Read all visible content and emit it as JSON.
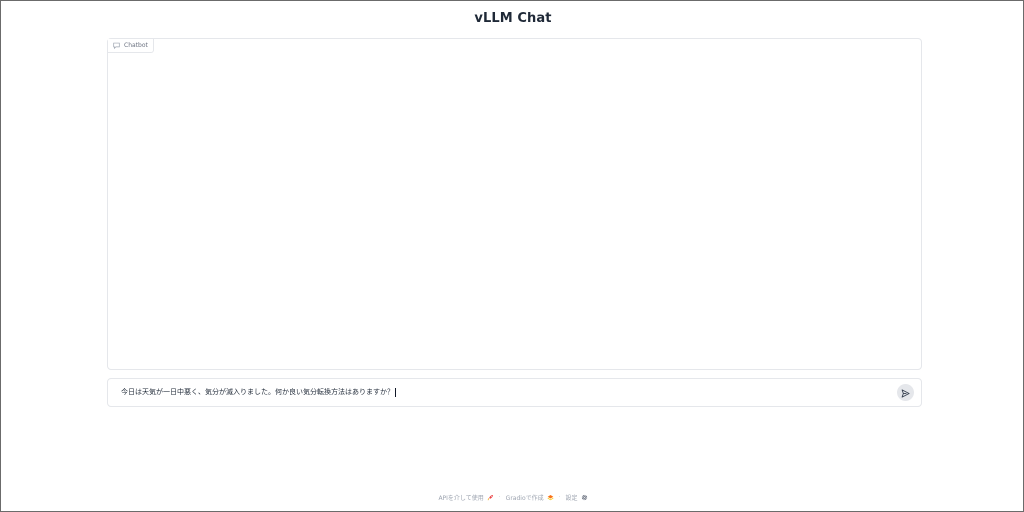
{
  "app": {
    "title": "vLLM Chat"
  },
  "chatbot": {
    "label": "Chatbot",
    "label_icon": "chat-bubble-icon"
  },
  "input": {
    "value": "今日は天気が一日中悪く、気分が滅入りました。何か良い気分転換方法はありますか？",
    "send_icon": "send-icon"
  },
  "footer": {
    "api_label": "APIを介して使用",
    "api_icon": "rocket-icon",
    "gradio_label": "Gradioで作成",
    "gradio_icon": "gradio-logo-icon",
    "settings_label": "設定",
    "settings_icon": "gear-icon",
    "separator": "·"
  }
}
